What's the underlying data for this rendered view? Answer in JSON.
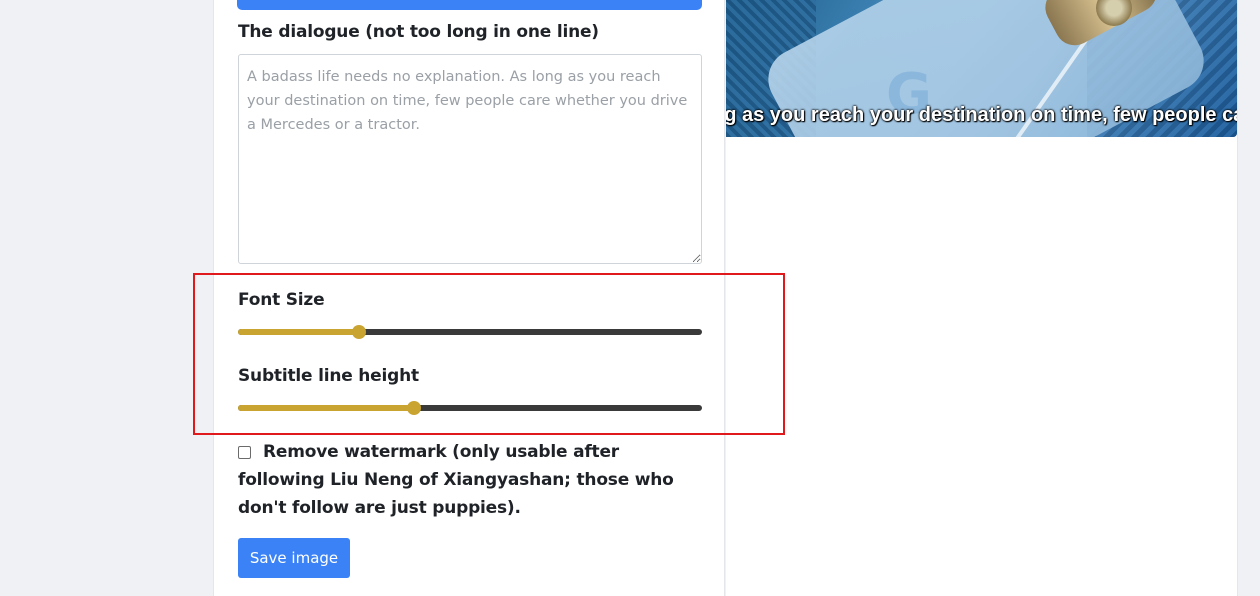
{
  "dialogue": {
    "label": "The dialogue (not too long in one line)",
    "placeholder": "A badass life needs no explanation. As long as you reach your destination on time, few people care whether you drive a Mercedes or a tractor.",
    "value": ""
  },
  "font_size": {
    "label": "Font Size",
    "value_fraction": 0.26
  },
  "line_height": {
    "label": "Subtitle line height",
    "value_fraction": 0.38
  },
  "watermark": {
    "label": "Remove watermark (only usable after following Liu Neng of Xiangyashan; those who don't follow are just puppies).",
    "checked": false
  },
  "save_button": {
    "label": "Save image"
  },
  "preview": {
    "subtitle": "ng as you reach your destination on time, few people care w",
    "logo_letter": "G"
  },
  "colors": {
    "accent": "#3b82f6",
    "slider": "#c9a431",
    "highlight": "#e0191c"
  }
}
